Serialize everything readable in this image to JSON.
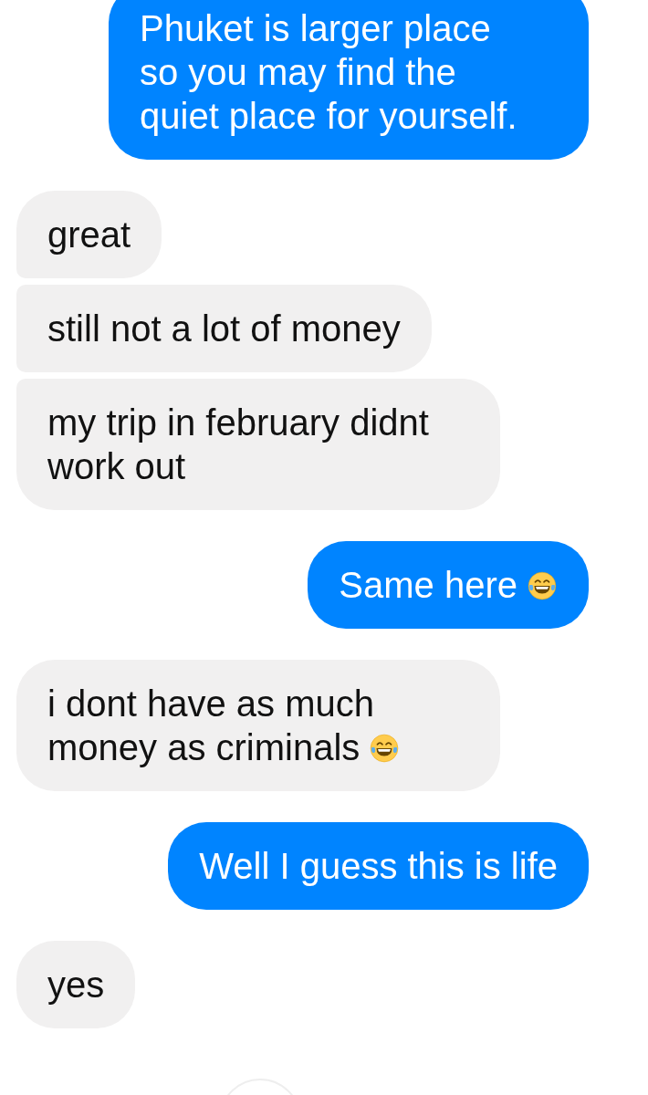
{
  "messages": [
    {
      "kind": "sent",
      "text": "Phuket is larger place so you may find the quiet place for yourself.",
      "emoji": false
    },
    {
      "kind": "received",
      "text": "great",
      "emoji": false
    },
    {
      "kind": "received",
      "text": "still not a lot of money",
      "emoji": false
    },
    {
      "kind": "received",
      "text": "my trip in february didnt work out",
      "emoji": false
    },
    {
      "kind": "sent",
      "text": "Same here",
      "emoji": true
    },
    {
      "kind": "received",
      "text": "i dont have as much money as criminals",
      "emoji": true
    },
    {
      "kind": "sent",
      "text": "Well I guess this is life",
      "emoji": false
    },
    {
      "kind": "received",
      "text": "yes",
      "emoji": false
    }
  ]
}
